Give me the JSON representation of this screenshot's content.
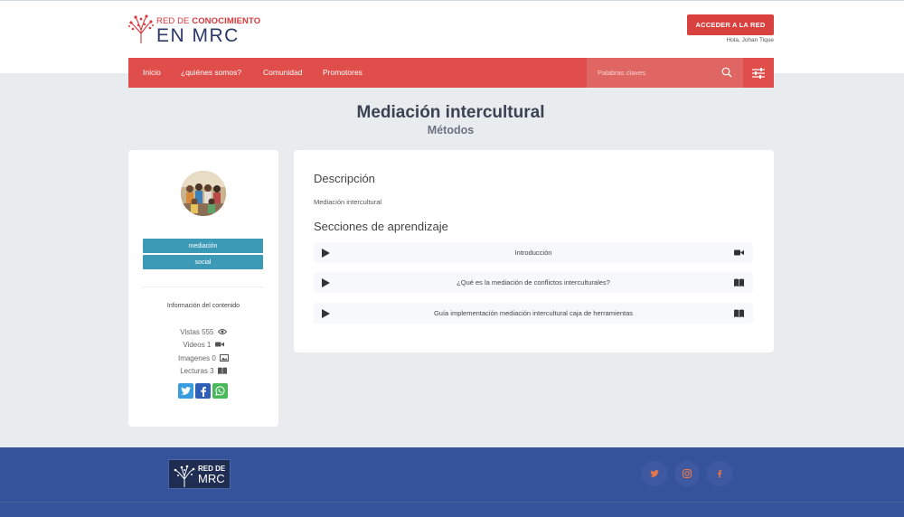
{
  "header": {
    "logo_line1_prefix": "RED DE ",
    "logo_line1_bold": "CONOCIMIENTO",
    "logo_line2": "EN MRC",
    "access_button": "ACCEDER A LA RED",
    "greeting": "Hola, Johan Tique"
  },
  "nav": {
    "items": [
      "Inicio",
      "¿quiénes somos?",
      "Comunidad",
      "Promotores"
    ],
    "search_placeholder": "Palabras claves",
    "search_icon": "search-icon",
    "filter_icon": "filter-icon"
  },
  "page": {
    "title": "Mediación intercultural",
    "subtitle": "Métodos"
  },
  "sidebar": {
    "tags": [
      "mediación",
      "social"
    ],
    "info_title": "Información del contenido",
    "stats": {
      "views_label": "Vistas 555",
      "videos_label": "Videos 1",
      "images_label": "Imagenes 0",
      "readings_label": "Lecturas 3"
    },
    "share": [
      "twitter",
      "facebook",
      "whatsapp"
    ]
  },
  "content": {
    "description_heading": "Descripción",
    "description_text": "Mediación intercultural",
    "sections_heading": "Secciones de aprendizaje",
    "sections": [
      {
        "label": "Introducción",
        "kind": "video-icon"
      },
      {
        "label": "¿Qué es la mediación de conflictos interculturales?",
        "kind": "book-icon"
      },
      {
        "label": "Guía implementación mediación intercultural caja de herramientas",
        "kind": "book-icon"
      }
    ]
  },
  "footer": {
    "logo_line1": "RED DE",
    "logo_line2": "MRC",
    "social": [
      "twitter-icon",
      "instagram-icon",
      "facebook-icon"
    ]
  },
  "colors": {
    "brand_red": "#df4e4b",
    "tag_blue": "#3c9ab6",
    "footer_blue": "#35539a"
  }
}
